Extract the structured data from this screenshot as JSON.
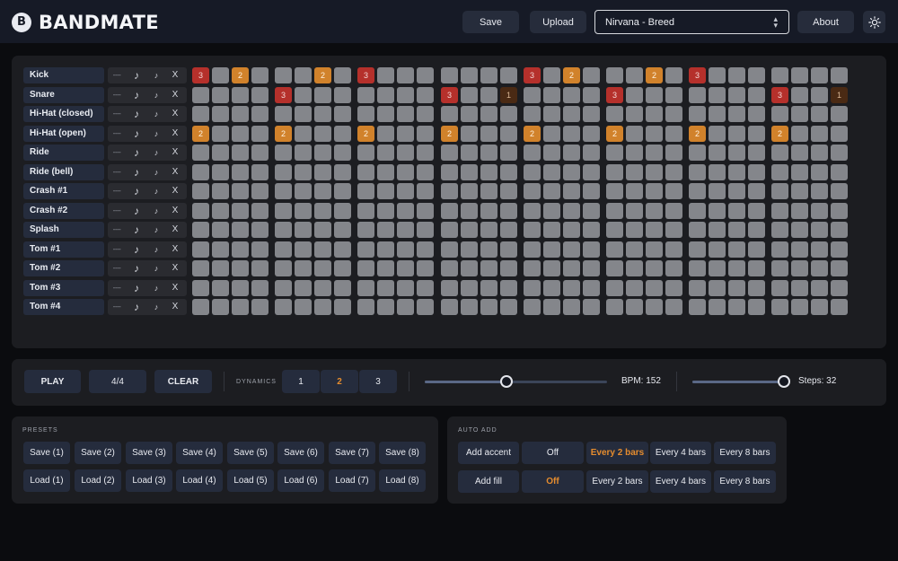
{
  "app": {
    "name": "BANDMATE"
  },
  "header": {
    "save_label": "Save",
    "upload_label": "Upload",
    "song_selected": "Nirvana - Breed",
    "about_label": "About",
    "theme_icon": "sun-icon"
  },
  "grid": {
    "rows": [
      {
        "label": "Kick",
        "dash": "----",
        "note1": "♪",
        "note2": "♪",
        "x": "X"
      },
      {
        "label": "Snare",
        "dash": "----",
        "note1": "♪",
        "note2": "♪",
        "x": "X"
      },
      {
        "label": "Hi-Hat (closed)",
        "dash": "----",
        "note1": "♪",
        "note2": "♪",
        "x": "X"
      },
      {
        "label": "Hi-Hat (open)",
        "dash": "----",
        "note1": "♪",
        "note2": "♪",
        "x": "X"
      },
      {
        "label": "Ride",
        "dash": "----",
        "note1": "♪",
        "note2": "♪",
        "x": "X"
      },
      {
        "label": "Ride (bell)",
        "dash": "----",
        "note1": "♪",
        "note2": "♪",
        "x": "X"
      },
      {
        "label": "Crash #1",
        "dash": "----",
        "note1": "♪",
        "note2": "♪",
        "x": "X"
      },
      {
        "label": "Crash #2",
        "dash": "----",
        "note1": "♪",
        "note2": "♪",
        "x": "X"
      },
      {
        "label": "Splash",
        "dash": "----",
        "note1": "♪",
        "note2": "♪",
        "x": "X"
      },
      {
        "label": "Tom #1",
        "dash": "----",
        "note1": "♪",
        "note2": "♪",
        "x": "X"
      },
      {
        "label": "Tom #2",
        "dash": "----",
        "note1": "♪",
        "note2": "♪",
        "x": "X"
      },
      {
        "label": "Tom #3",
        "dash": "----",
        "note1": "♪",
        "note2": "♪",
        "x": "X"
      },
      {
        "label": "Tom #4",
        "dash": "----",
        "note1": "♪",
        "note2": "♪",
        "x": "X"
      }
    ],
    "steps": [
      [
        3,
        0,
        2,
        0,
        0,
        0,
        2,
        0,
        3,
        0,
        0,
        0,
        0,
        0,
        0,
        0,
        3,
        0,
        2,
        0,
        0,
        0,
        2,
        0,
        3,
        0,
        0,
        0,
        0,
        0,
        0,
        0
      ],
      [
        0,
        0,
        0,
        0,
        3,
        0,
        0,
        0,
        0,
        0,
        0,
        0,
        3,
        0,
        0,
        1,
        0,
        0,
        0,
        0,
        3,
        0,
        0,
        0,
        0,
        0,
        0,
        0,
        3,
        0,
        0,
        1
      ],
      [
        0,
        0,
        0,
        0,
        0,
        0,
        0,
        0,
        0,
        0,
        0,
        0,
        0,
        0,
        0,
        0,
        0,
        0,
        0,
        0,
        0,
        0,
        0,
        0,
        0,
        0,
        0,
        0,
        0,
        0,
        0,
        0
      ],
      [
        2,
        0,
        0,
        0,
        2,
        0,
        0,
        0,
        2,
        0,
        0,
        0,
        2,
        0,
        0,
        0,
        2,
        0,
        0,
        0,
        2,
        0,
        0,
        0,
        2,
        0,
        0,
        0,
        2,
        0,
        0,
        0
      ],
      [
        0,
        0,
        0,
        0,
        0,
        0,
        0,
        0,
        0,
        0,
        0,
        0,
        0,
        0,
        0,
        0,
        0,
        0,
        0,
        0,
        0,
        0,
        0,
        0,
        0,
        0,
        0,
        0,
        0,
        0,
        0,
        0
      ],
      [
        0,
        0,
        0,
        0,
        0,
        0,
        0,
        0,
        0,
        0,
        0,
        0,
        0,
        0,
        0,
        0,
        0,
        0,
        0,
        0,
        0,
        0,
        0,
        0,
        0,
        0,
        0,
        0,
        0,
        0,
        0,
        0
      ],
      [
        0,
        0,
        0,
        0,
        0,
        0,
        0,
        0,
        0,
        0,
        0,
        0,
        0,
        0,
        0,
        0,
        0,
        0,
        0,
        0,
        0,
        0,
        0,
        0,
        0,
        0,
        0,
        0,
        0,
        0,
        0,
        0
      ],
      [
        0,
        0,
        0,
        0,
        0,
        0,
        0,
        0,
        0,
        0,
        0,
        0,
        0,
        0,
        0,
        0,
        0,
        0,
        0,
        0,
        0,
        0,
        0,
        0,
        0,
        0,
        0,
        0,
        0,
        0,
        0,
        0
      ],
      [
        0,
        0,
        0,
        0,
        0,
        0,
        0,
        0,
        0,
        0,
        0,
        0,
        0,
        0,
        0,
        0,
        0,
        0,
        0,
        0,
        0,
        0,
        0,
        0,
        0,
        0,
        0,
        0,
        0,
        0,
        0,
        0
      ],
      [
        0,
        0,
        0,
        0,
        0,
        0,
        0,
        0,
        0,
        0,
        0,
        0,
        0,
        0,
        0,
        0,
        0,
        0,
        0,
        0,
        0,
        0,
        0,
        0,
        0,
        0,
        0,
        0,
        0,
        0,
        0,
        0
      ],
      [
        0,
        0,
        0,
        0,
        0,
        0,
        0,
        0,
        0,
        0,
        0,
        0,
        0,
        0,
        0,
        0,
        0,
        0,
        0,
        0,
        0,
        0,
        0,
        0,
        0,
        0,
        0,
        0,
        0,
        0,
        0,
        0
      ],
      [
        0,
        0,
        0,
        0,
        0,
        0,
        0,
        0,
        0,
        0,
        0,
        0,
        0,
        0,
        0,
        0,
        0,
        0,
        0,
        0,
        0,
        0,
        0,
        0,
        0,
        0,
        0,
        0,
        0,
        0,
        0,
        0
      ],
      [
        0,
        0,
        0,
        0,
        0,
        0,
        0,
        0,
        0,
        0,
        0,
        0,
        0,
        0,
        0,
        0,
        0,
        0,
        0,
        0,
        0,
        0,
        0,
        0,
        0,
        0,
        0,
        0,
        0,
        0,
        0,
        0
      ]
    ]
  },
  "transport": {
    "play_label": "PLAY",
    "time_sig_label": "4/4",
    "clear_label": "CLEAR",
    "dynamics_label": "DYNAMICS",
    "dynamics_options": [
      "1",
      "2",
      "3"
    ],
    "dynamics_selected": "2",
    "bpm_label": "BPM: 152",
    "bpm_value": 152,
    "bpm_slider_fraction": 0.45,
    "steps_label": "Steps: 32",
    "steps_value": 32,
    "steps_slider_fraction": 1.0
  },
  "presets": {
    "title": "PRESETS",
    "save_labels": [
      "Save (1)",
      "Save (2)",
      "Save (3)",
      "Save (4)",
      "Save (5)",
      "Save (6)",
      "Save (7)",
      "Save (8)"
    ],
    "load_labels": [
      "Load (1)",
      "Load (2)",
      "Load (3)",
      "Load (4)",
      "Load (5)",
      "Load (6)",
      "Load (7)",
      "Load (8)"
    ]
  },
  "auto_add": {
    "title": "AUTO ADD",
    "accent": {
      "label": "Add accent",
      "options": [
        "Off",
        "Every 2 bars",
        "Every 4 bars",
        "Every 8 bars"
      ],
      "selected": "Every 2 bars"
    },
    "fill": {
      "label": "Add fill",
      "options": [
        "Off",
        "Every 2 bars",
        "Every 4 bars",
        "Every 8 bars"
      ],
      "selected": "Off"
    }
  },
  "colors": {
    "accent": "#e58c2e",
    "step_off": "#84868b",
    "step_velocity_3": "#b5302b",
    "step_velocity_2": "#d1822b",
    "step_velocity_1": "#4a2a14"
  }
}
